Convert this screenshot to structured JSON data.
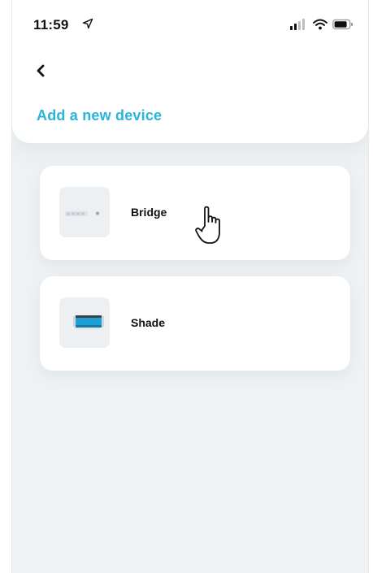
{
  "status_bar": {
    "time": "11:59",
    "icons": [
      "location-arrow-icon",
      "signal-icon",
      "wifi-icon",
      "battery-icon"
    ]
  },
  "nav": {
    "back_icon": "chevron-left-icon",
    "title": "Add a new device"
  },
  "devices": [
    {
      "label": "Bridge",
      "thumbnail_icon": "bridge-device-icon"
    },
    {
      "label": "Shade",
      "thumbnail_icon": "shade-device-icon"
    }
  ],
  "overlay": {
    "cursor_icon": "hand-pointer-icon"
  },
  "colors": {
    "accent": "#2bb3dc",
    "background": "#eef2f4",
    "card": "#ffffff",
    "text": "#111111",
    "shade_blue": "#1e9fd6"
  }
}
